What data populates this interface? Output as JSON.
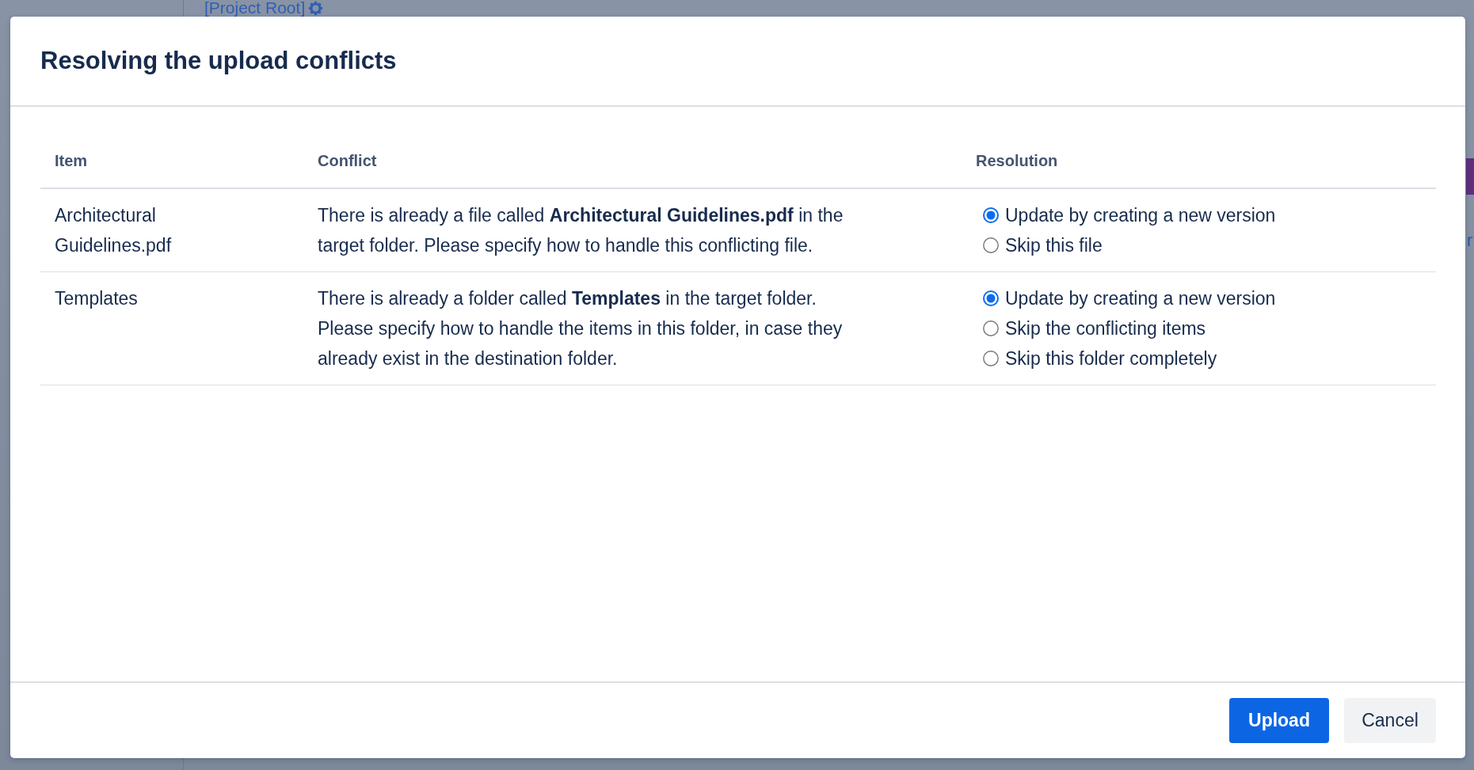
{
  "background": {
    "breadcrumb": "[Project Root]",
    "side_text": "r"
  },
  "dialog": {
    "title": "Resolving the upload conflicts",
    "table": {
      "columns": [
        "Item",
        "Conflict",
        "Resolution"
      ],
      "rows": [
        {
          "item": "Architectural Guidelines.pdf",
          "conflict": "There is already a file called **Architectural Guidelines.pdf** in the target folder. Please specify how to handle this conflicting file.",
          "options": [
            {
              "label": "Update by creating a new version",
              "selected": true
            },
            {
              "label": "Skip this file",
              "selected": false
            }
          ]
        },
        {
          "item": "Templates",
          "conflict": "There is already a folder called **Templates** in the target folder. Please specify how to handle the items in this folder, in case they already exist in the destination folder.",
          "options": [
            {
              "label": "Update by creating a new version",
              "selected": true
            },
            {
              "label": "Skip the conflicting items",
              "selected": false
            },
            {
              "label": "Skip this folder completely",
              "selected": false
            }
          ]
        }
      ]
    },
    "buttons": [
      {
        "label": "Upload",
        "kind": "primary"
      },
      {
        "label": "Cancel",
        "kind": "secondary"
      }
    ]
  }
}
